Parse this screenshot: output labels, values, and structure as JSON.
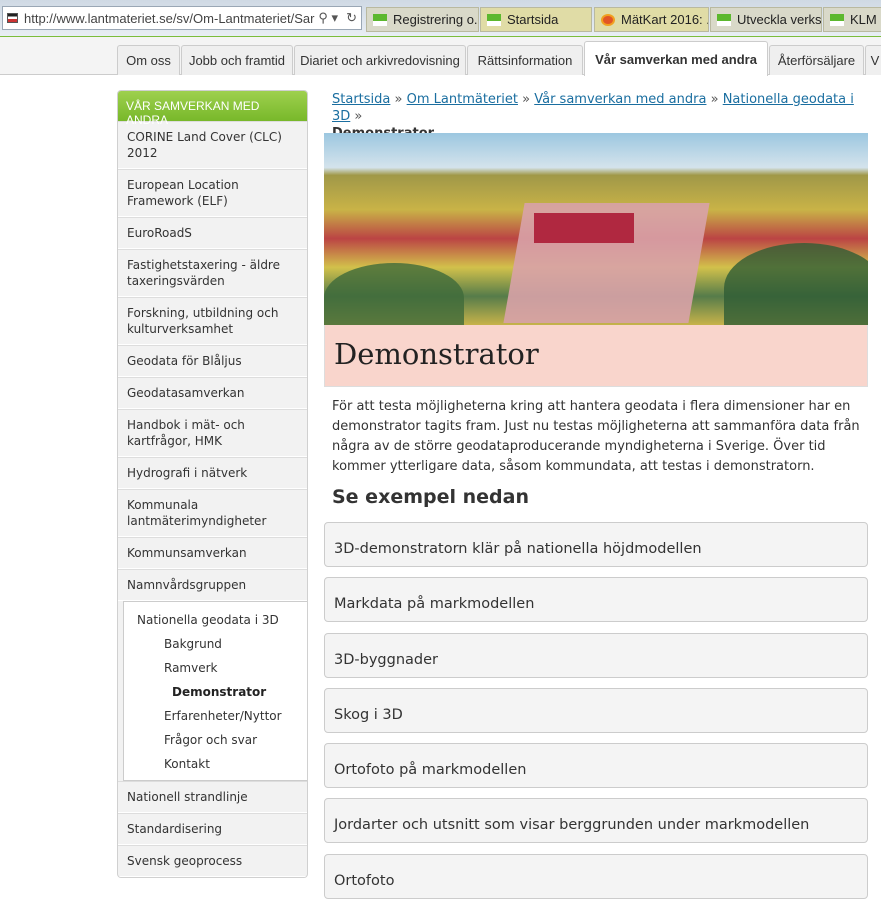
{
  "browser": {
    "url": "http://www.lantmateriet.se/sv/Om-Lantmateriet/Sar",
    "tabs": [
      "Registrering o...",
      "Startsida",
      "MätKart 2016: ...",
      "Utveckla verks...",
      "KLM i"
    ]
  },
  "nav": {
    "tabs": [
      "Om oss",
      "Jobb och framtid",
      "Diariet och arkivredovisning",
      "Rättsinformation",
      "Vår samverkan med andra",
      "Återförsäljare",
      "V"
    ],
    "active": "Vår samverkan med andra"
  },
  "sidebar": {
    "header": "VÅR SAMVERKAN MED ANDRA",
    "items_top": [
      "CORINE Land Cover (CLC) 2012",
      "European Location Framework (ELF)",
      "EuroRoadS",
      "Fastighetstaxering - äldre taxeringsvärden",
      "Forskning, utbildning och kulturverksamhet",
      "Geodata för Blåljus",
      "Geodatasamverkan",
      "Handbok i mät- och kartfrågor, HMK",
      "Hydrografi i nätverk",
      "Kommunala lantmäterimyndigheter",
      "Kommunsamverkan",
      "Namnvårdsgruppen"
    ],
    "sub": {
      "parent": "Nationella geodata i 3D",
      "children": [
        "Bakgrund",
        "Ramverk",
        "Demonstrator",
        "Erfarenheter/Nyttor",
        "Frågor och svar",
        "Kontakt"
      ],
      "current": "Demonstrator"
    },
    "items_bottom": [
      "Nationell strandlinje",
      "Standardisering",
      "Svensk geoprocess"
    ]
  },
  "breadcrumb": {
    "links": [
      "Startsida",
      "Om Lantmäteriet",
      "Vår samverkan med andra",
      "Nationella geodata i 3D"
    ],
    "sep": "»",
    "current": "Demonstrator"
  },
  "main": {
    "title": "Demonstrator",
    "intro": "För att testa möjligheterna kring att hantera geodata i flera dimensioner har en demonstrator tagits fram. Just nu testas möjligheterna att sammanföra data från några av de större geodataproducerande myndigheterna i Sverige. Över tid kommer ytterligare data, såsom kommundata, att testas i demonstratorn.",
    "examples_heading": "Se exempel nedan",
    "examples": [
      "3D-demonstratorn klär på nationella höjdmodellen",
      "Markdata på markmodellen",
      "3D-byggnader",
      "Skog i 3D",
      "Ortofoto på markmodellen",
      "Jordarter och utsnitt som visar berggrunden under markmodellen",
      "Ortofoto"
    ]
  },
  "colors": {
    "accent_green": "#78b82a",
    "link": "#1a6ea0",
    "title_bg": "#f9d5cc"
  }
}
